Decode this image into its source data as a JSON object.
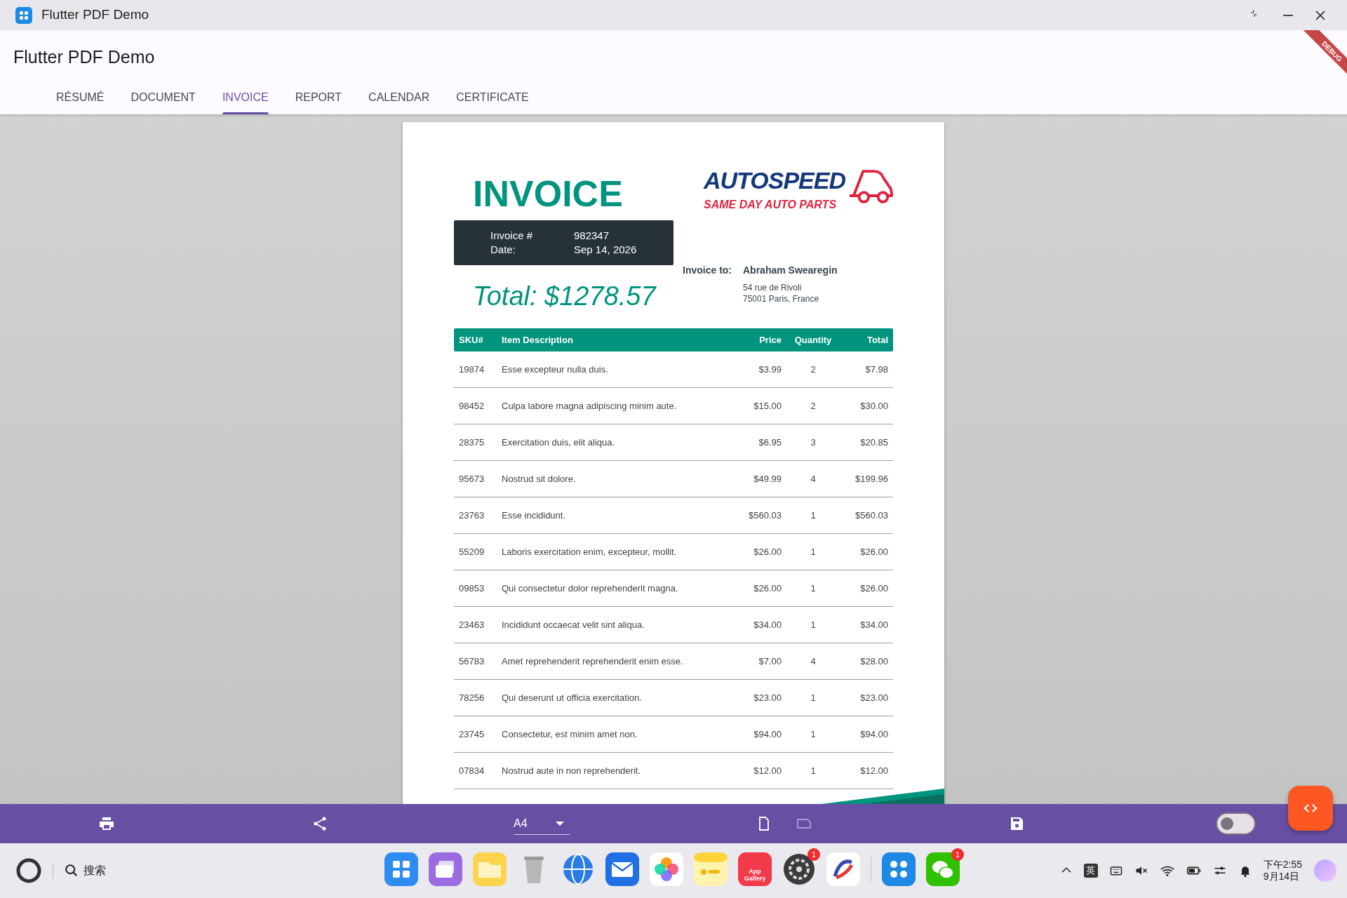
{
  "window": {
    "title": "Flutter PDF Demo"
  },
  "app_bar": {
    "title": "Flutter PDF Demo",
    "debug_banner": "DEBUG",
    "tabs": [
      {
        "label": "RÉSUMÉ",
        "selected": false
      },
      {
        "label": "DOCUMENT",
        "selected": false
      },
      {
        "label": "INVOICE",
        "selected": true
      },
      {
        "label": "REPORT",
        "selected": false
      },
      {
        "label": "CALENDAR",
        "selected": false
      },
      {
        "label": "CERTIFICATE",
        "selected": false
      }
    ]
  },
  "invoice": {
    "title": "INVOICE",
    "meta": [
      {
        "label": "Invoice #",
        "value": "982347"
      },
      {
        "label": "Date:",
        "value": "Sep 14, 2026"
      }
    ],
    "total": "Total: $1278.57",
    "logo": {
      "name": "AUTOSPEED",
      "tagline": "SAME DAY AUTO PARTS"
    },
    "bill_to": {
      "label": "Invoice to:",
      "name": "Abraham Swearegin",
      "address": [
        "54 rue de Rivoli",
        "75001 Paris, France"
      ]
    },
    "table": {
      "columns": [
        "SKU#",
        "Item Description",
        "Price",
        "Quantity",
        "Total"
      ],
      "rows": [
        [
          "19874",
          "Esse excepteur nulla duis.",
          "$3.99",
          "2",
          "$7.98"
        ],
        [
          "98452",
          "Culpa labore magna adipiscing minim aute.",
          "$15.00",
          "2",
          "$30.00"
        ],
        [
          "28375",
          "Exercitation duis, elit aliqua.",
          "$6.95",
          "3",
          "$20.85"
        ],
        [
          "95673",
          "Nostrud sit dolore.",
          "$49.99",
          "4",
          "$199.96"
        ],
        [
          "23763",
          "Esse incididunt.",
          "$560.03",
          "1",
          "$560.03"
        ],
        [
          "55209",
          "Laboris exercitation enim, excepteur, mollit.",
          "$26.00",
          "1",
          "$26.00"
        ],
        [
          "09853",
          "Qui consectetur dolor reprehenderit magna.",
          "$26.00",
          "1",
          "$26.00"
        ],
        [
          "23463",
          "Incididunt occaecat velit sint aliqua.",
          "$34.00",
          "1",
          "$34.00"
        ],
        [
          "56783",
          "Amet reprehenderit reprehenderit enim esse.",
          "$7.00",
          "4",
          "$28.00"
        ],
        [
          "78256",
          "Qui deserunt ut officia exercitation.",
          "$23.00",
          "1",
          "$23.00"
        ],
        [
          "23745",
          "Consectetur, est minim amet non.",
          "$94.00",
          "1",
          "$94.00"
        ],
        [
          "07834",
          "Nostrud aute in non reprehenderit.",
          "$12.00",
          "1",
          "$12.00"
        ]
      ]
    }
  },
  "toolbar": {
    "page_size": "A4",
    "orientations": [
      {
        "kind": "portrait",
        "disabled": false
      },
      {
        "kind": "landscape",
        "disabled": true
      }
    ],
    "toggle": {
      "on": false
    }
  },
  "taskbar": {
    "search_label": "搜索",
    "apps": [
      {
        "kind": "launcher"
      },
      {
        "kind": "windows"
      },
      {
        "kind": "files"
      },
      {
        "kind": "trash"
      },
      {
        "kind": "browser"
      },
      {
        "kind": "mail"
      },
      {
        "kind": "photos"
      },
      {
        "kind": "notes"
      },
      {
        "kind": "gallery",
        "label": "App Gallery"
      },
      {
        "kind": "settings",
        "badge": "1"
      },
      {
        "kind": "arc"
      },
      {
        "kind": "separator"
      },
      {
        "kind": "grid"
      },
      {
        "kind": "chat",
        "badge": "1"
      }
    ],
    "tray": {
      "input_method": "英",
      "time": "下午2:55",
      "date": "9月14日"
    }
  }
}
